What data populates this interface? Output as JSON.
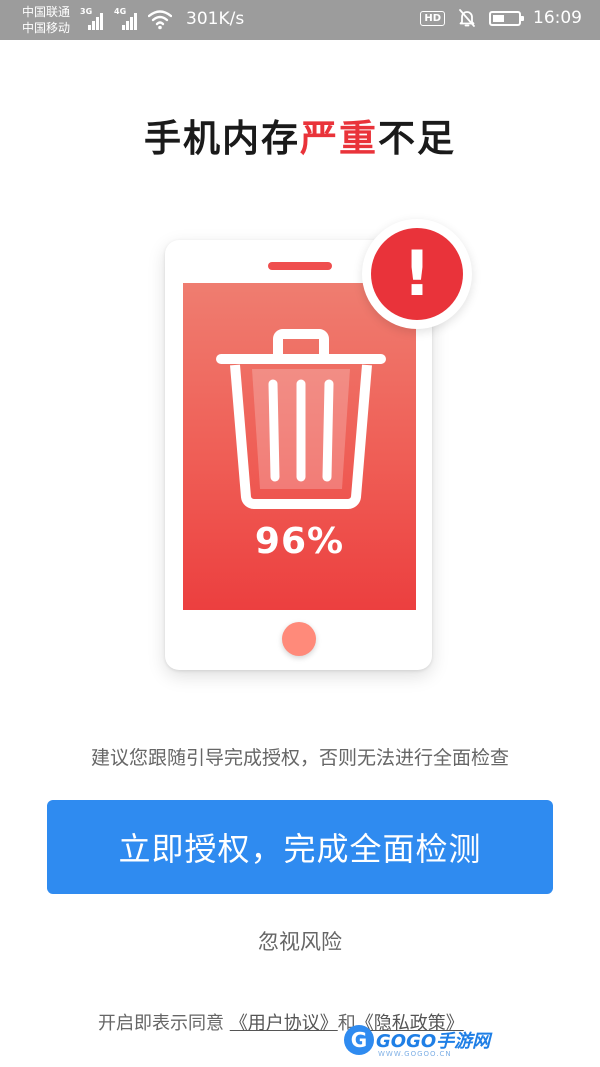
{
  "status_bar": {
    "carrier_1": "中国联通",
    "carrier_2": "中国移动",
    "signal_1_tag": "3G",
    "signal_2_tag": "4G",
    "net_speed": "301K/s",
    "hd_label": "HD",
    "time": "16:09",
    "battery_level": 0.45,
    "icons": [
      "signal-icon",
      "wifi-icon",
      "hd-icon",
      "bell-off-icon",
      "battery-icon"
    ]
  },
  "title": {
    "part_1": "手机内存",
    "highlight": "严重",
    "part_2": "不足"
  },
  "illustration": {
    "memory_percent": "96%",
    "alert_symbol": "!",
    "icons": [
      "phone-icon",
      "trash-icon",
      "alert-icon"
    ]
  },
  "hint_text": "建议您跟随引导完成授权，否则无法进行全面检查",
  "authorize_button_label": "立即授权，完成全面检测",
  "ignore_label": "忽视风险",
  "agreement": {
    "prefix": "开启即表示同意",
    "user_agreement": "《用户协议》",
    "connector": "和",
    "privacy_policy": "《隐私政策》"
  },
  "watermark": {
    "logo_letter": "G",
    "text": "GOGO手游网",
    "sub": "WWW.GOGOO.CN"
  },
  "colors": {
    "accent_blue": "#2f8bf0",
    "warning_red": "#e9333a",
    "status_bar_bg": "#9c9c9c"
  }
}
